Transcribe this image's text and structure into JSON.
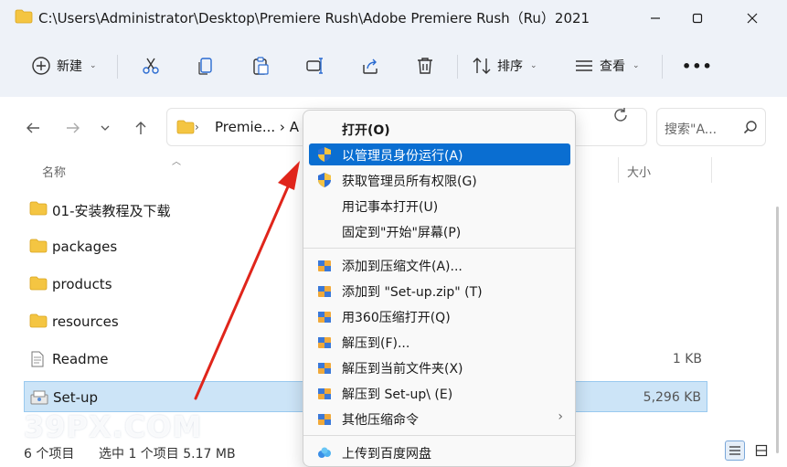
{
  "window": {
    "title": "C:\\Users\\Administrator\\Desktop\\Premiere Rush\\Adobe Premiere Rush（Ru）2021",
    "controls": [
      "minimize",
      "maximize",
      "close"
    ]
  },
  "toolbar": {
    "new_label": "新建",
    "sort_label": "排序",
    "view_label": "查看",
    "more_label": "•••"
  },
  "address": {
    "path_text": "Premie...  ›  A",
    "search_placeholder": "搜索\"A...",
    "chevron": "›"
  },
  "columns": {
    "name": "名称",
    "size": "大小"
  },
  "files": [
    {
      "name": "01-安装教程及下载",
      "type": "folder",
      "size": ""
    },
    {
      "name": "packages",
      "type": "folder",
      "size": ""
    },
    {
      "name": "products",
      "type": "folder",
      "size": ""
    },
    {
      "name": "resources",
      "type": "folder",
      "size": ""
    },
    {
      "name": "Readme",
      "type": "text",
      "size": "1 KB"
    },
    {
      "name": "Set-up",
      "type": "exe",
      "size": "5,296 KB",
      "selected": true
    }
  ],
  "status": {
    "count": "6 个项目",
    "selected": "选中 1 个项目  5.17 MB"
  },
  "watermark": "39PX.COM",
  "context_menu": {
    "items": [
      {
        "label": "打开(O)",
        "bold": true,
        "icon": "none"
      },
      {
        "label": "以管理员身份运行(A)",
        "icon": "shield-icon",
        "highlighted": true
      },
      {
        "label": "获取管理员所有权限(G)",
        "icon": "shield-icon"
      },
      {
        "label": "用记事本打开(U)",
        "icon": "none"
      },
      {
        "label": "固定到\"开始\"屏幕(P)",
        "icon": "none"
      },
      {
        "label": "添加到压缩文件(A)...",
        "icon": "archive-icon"
      },
      {
        "label": "添加到 \"Set-up.zip\" (T)",
        "icon": "archive-icon"
      },
      {
        "label": "用360压缩打开(Q)",
        "icon": "archive-icon"
      },
      {
        "label": "解压到(F)...",
        "icon": "archive-icon"
      },
      {
        "label": "解压到当前文件夹(X)",
        "icon": "archive-icon"
      },
      {
        "label": "解压到 Set-up\\ (E)",
        "icon": "archive-icon"
      },
      {
        "label": "其他压缩命令",
        "icon": "archive-icon",
        "submenu": true
      },
      {
        "label": "上传到百度网盘",
        "icon": "cloud-icon"
      }
    ],
    "submenu_arrow": "›"
  },
  "colors": {
    "accent": "#0a6ed1",
    "selection": "#cce4f7",
    "folder": "#f4c542",
    "annotation_arrow": "#e0251b"
  }
}
